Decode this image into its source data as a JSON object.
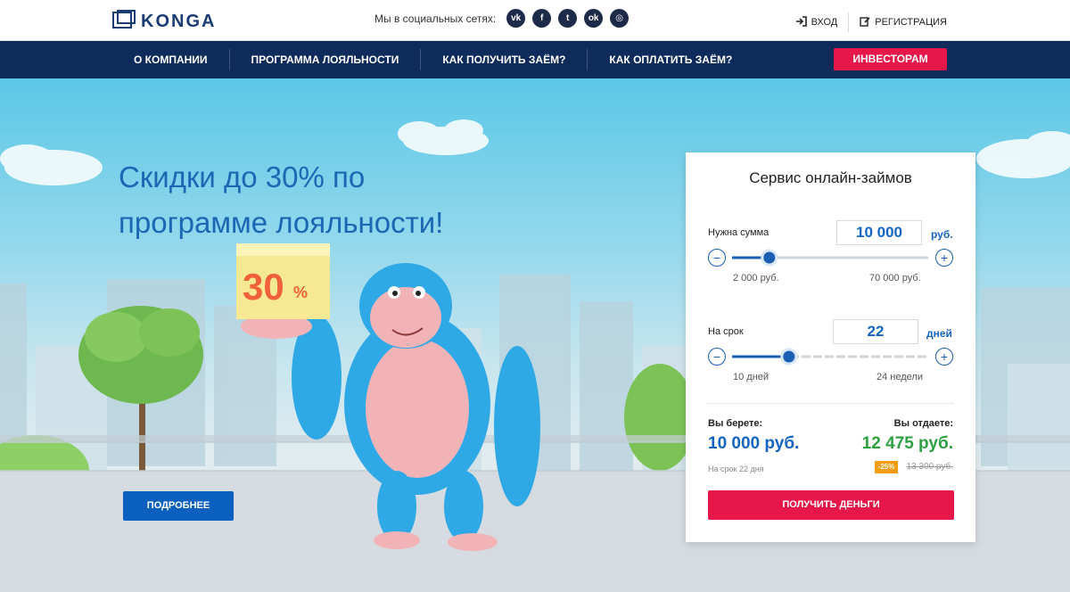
{
  "header": {
    "logo_text": "KONGA",
    "social_label": "Мы в социальных сетях:",
    "social_icons": [
      "vk-icon",
      "facebook-icon",
      "twitter-icon",
      "odnoklassniki-icon",
      "instagram-icon"
    ],
    "social_glyphs": [
      "vk",
      "f",
      "t",
      "ok",
      "◎"
    ],
    "login_label": "ВХОД",
    "register_label": "РЕГИСТРАЦИЯ"
  },
  "nav": {
    "items": [
      "О КОМПАНИИ",
      "ПРОГРАММА ЛОЯЛЬНОСТИ",
      "КАК ПОЛУЧИТЬ ЗАЁМ?",
      "КАК ОПЛАТИТЬ ЗАЁМ?"
    ],
    "cta_label": "ИНВЕСТОРАМ"
  },
  "hero": {
    "headline_line1": "Скидки до 30% по",
    "headline_line2": "программе лояльности!",
    "box_number": "30",
    "box_percent": "%",
    "more_label": "ПОДРОБНЕЕ"
  },
  "calculator": {
    "title": "Сервис онлайн-займов",
    "amount": {
      "label": "Нужна сумма",
      "value": "10 000",
      "unit": "руб.",
      "min_label": "2 000 руб.",
      "max_label": "70 000 руб.",
      "fill_fraction": 0.19
    },
    "term": {
      "label": "На срок",
      "value": "22",
      "unit": "дней",
      "min_label": "10 дней",
      "max_label": "24 недели",
      "fill_fraction": 0.29
    },
    "minus": "−",
    "plus": "+",
    "take_label": "Вы берете:",
    "take_value": "10 000 руб.",
    "give_label": "Вы отдаете:",
    "give_value": "12 475 руб.",
    "term_note": "На срок 22 дня",
    "discount_badge": "-25%",
    "old_price": "13 300 руб.",
    "submit_label": "ПОЛУЧИТЬ ДЕНЬГИ"
  },
  "colors": {
    "brand_navy": "#0f2b5b",
    "accent_red": "#e8174a",
    "brand_blue": "#1565c0",
    "give_green": "#2ea043"
  }
}
